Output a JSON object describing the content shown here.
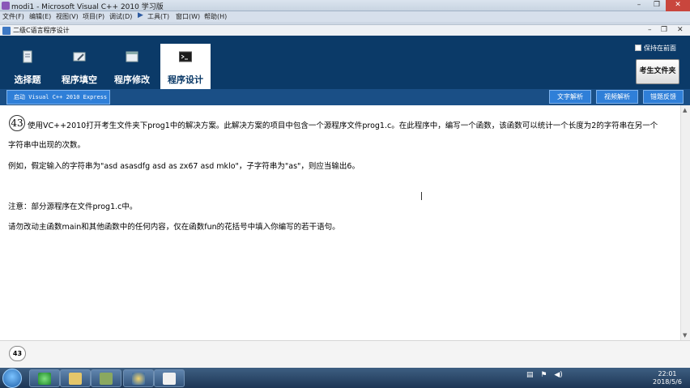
{
  "os_window": {
    "title": "modi1 - Microsoft Visual C++ 2010 学习版",
    "controls": [
      "–",
      "❐",
      "✕"
    ]
  },
  "menu": [
    "文件(F)",
    "编辑(E)",
    "视图(V)",
    "项目(P)",
    "调试(D)",
    "工具(T)",
    "窗口(W)",
    "帮助(H)"
  ],
  "app_window": {
    "title": "二级C语言程序设计",
    "controls": [
      "–",
      "❐",
      "✕"
    ]
  },
  "nav_tabs": [
    {
      "label": "选择题",
      "icon": "document-icon",
      "active": false
    },
    {
      "label": "程序填空",
      "icon": "edit-box-icon",
      "active": false
    },
    {
      "label": "程序修改",
      "icon": "window-icon",
      "active": false
    },
    {
      "label": "程序设计",
      "icon": "terminal-icon",
      "active": true
    }
  ],
  "keep_front_label": "保持在前面",
  "exam_folder_label": "考生文件夹",
  "launch_label": "启动 Visual C++ 2010 Express",
  "right_buttons": [
    "文字解析",
    "视频解析",
    "错题反馈"
  ],
  "question": {
    "number": "43",
    "line1": "使用VC++2010打开考生文件夹下prog1中的解决方案。此解决方案的项目中包含一个源程序文件prog1.c。在此程序中，编写一个函数，该函数可以统计一个长度为2的字符串在另一个",
    "line2": "字符串中出现的次数。",
    "example": "例如，假定输入的字符串为\"asd asasdfg asd as zx67 asd mklo\"，子字符串为\"as\"，则应当输出6。",
    "note1": "注意：部分源程序在文件prog1.c中。",
    "note2": "请勿改动主函数main和其他函数中的任何内容，仅在函数fun的花括号中填入你编写的若干语句。"
  },
  "bottom_qnum": "43",
  "tray_icons": [
    "network-icon",
    "volume-icon",
    "flag-icon"
  ],
  "clock": {
    "time": "22:01",
    "date": "2018/5/6"
  },
  "colors": {
    "header": "#0b3a68",
    "strip": "#1a4f86",
    "button": "#2f7fd8"
  }
}
